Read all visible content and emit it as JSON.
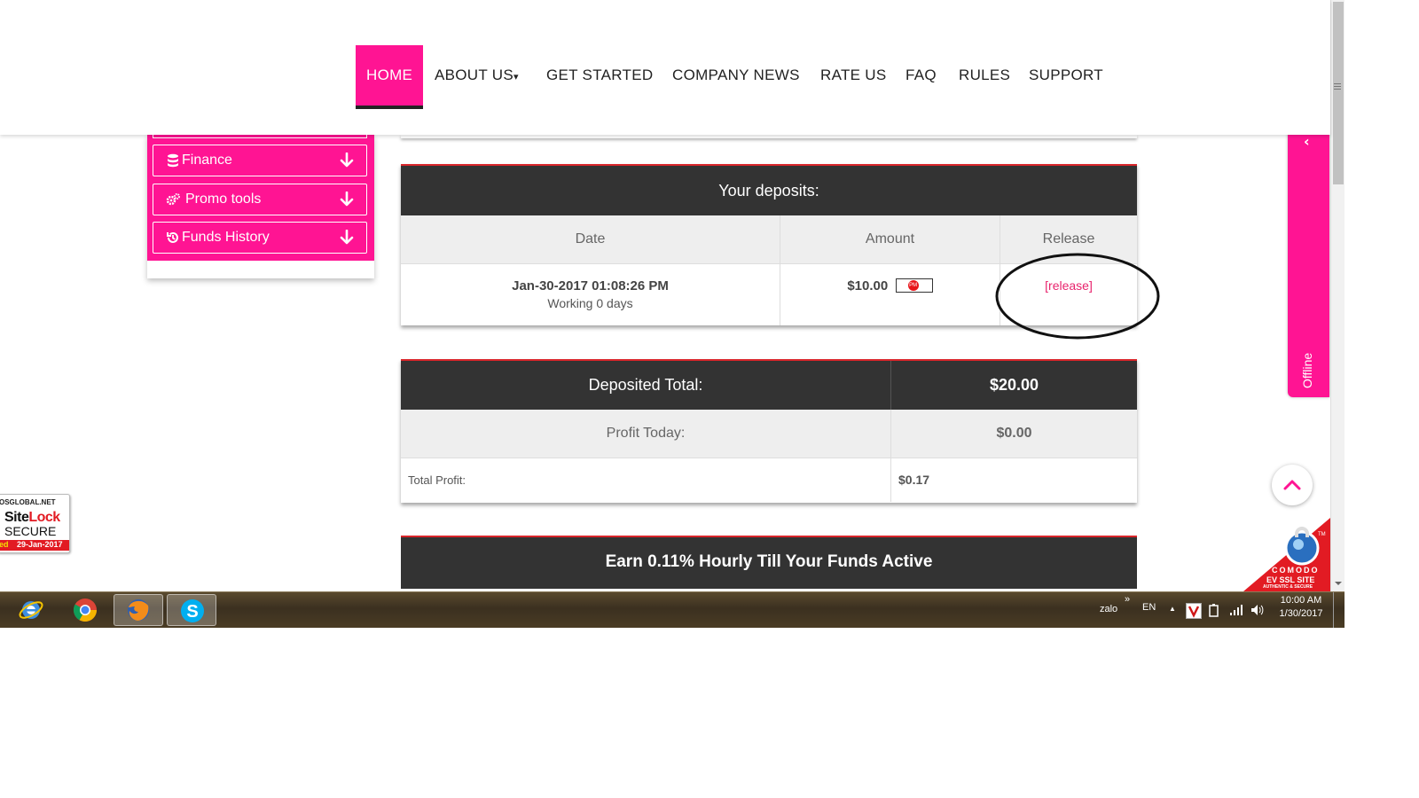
{
  "nav": {
    "items": [
      {
        "label": "HOME",
        "active": true
      },
      {
        "label": "ABOUT US"
      },
      {
        "label": "GET STARTED"
      },
      {
        "label": "COMPANY NEWS"
      },
      {
        "label": "RATE US"
      },
      {
        "label": "FAQ"
      },
      {
        "label": "RULES"
      },
      {
        "label": "SUPPORT"
      }
    ],
    "about_caret": "▾"
  },
  "sidebar": {
    "items": [
      {
        "label": "Finance",
        "icon": "database-icon"
      },
      {
        "label": "Promo tools",
        "icon": "cogs-icon"
      },
      {
        "label": "Funds History",
        "icon": "history-icon"
      }
    ]
  },
  "deposits": {
    "title": "Your deposits:",
    "columns": [
      "Date",
      "Amount",
      "Release"
    ],
    "row": {
      "date": "Jan-30-2017 01:08:26 PM",
      "working": "Working 0 days",
      "amount": "$10.00",
      "amount_badge": "PM",
      "release": "[release]"
    }
  },
  "totals": {
    "deposited_label": "Deposited Total:",
    "deposited_value": "$20.00",
    "profit_today_label": "Profit Today:",
    "profit_today_value": "$0.00",
    "total_profit_label": "Total Profit:",
    "total_profit_value": "$0.17"
  },
  "earn_banner": "Earn 0.11% Hourly Till Your Funds Active",
  "chat": {
    "status": "Offline",
    "chevron": "‹"
  },
  "sitelock": {
    "domain": "OSGLOBAL.NET",
    "brand_a": "Site",
    "brand_b": "Lock",
    "secure": "SECURE",
    "verified": "ed",
    "date": "29-Jan-2017"
  },
  "comodo": {
    "brand": "COMODO",
    "line1": "EV SSL SITE",
    "line2": "AUTHENTIC & SECURE",
    "tm": "TM"
  },
  "taskbar": {
    "tray_app": "zalo",
    "tray_more": "»",
    "lang": "EN",
    "up_arrow": "▲",
    "time": "10:00 AM",
    "date": "1/30/2017"
  },
  "colors": {
    "accent": "#ff1493",
    "dark": "#333333",
    "red_line": "#d9252a",
    "link": "#e8246d"
  }
}
